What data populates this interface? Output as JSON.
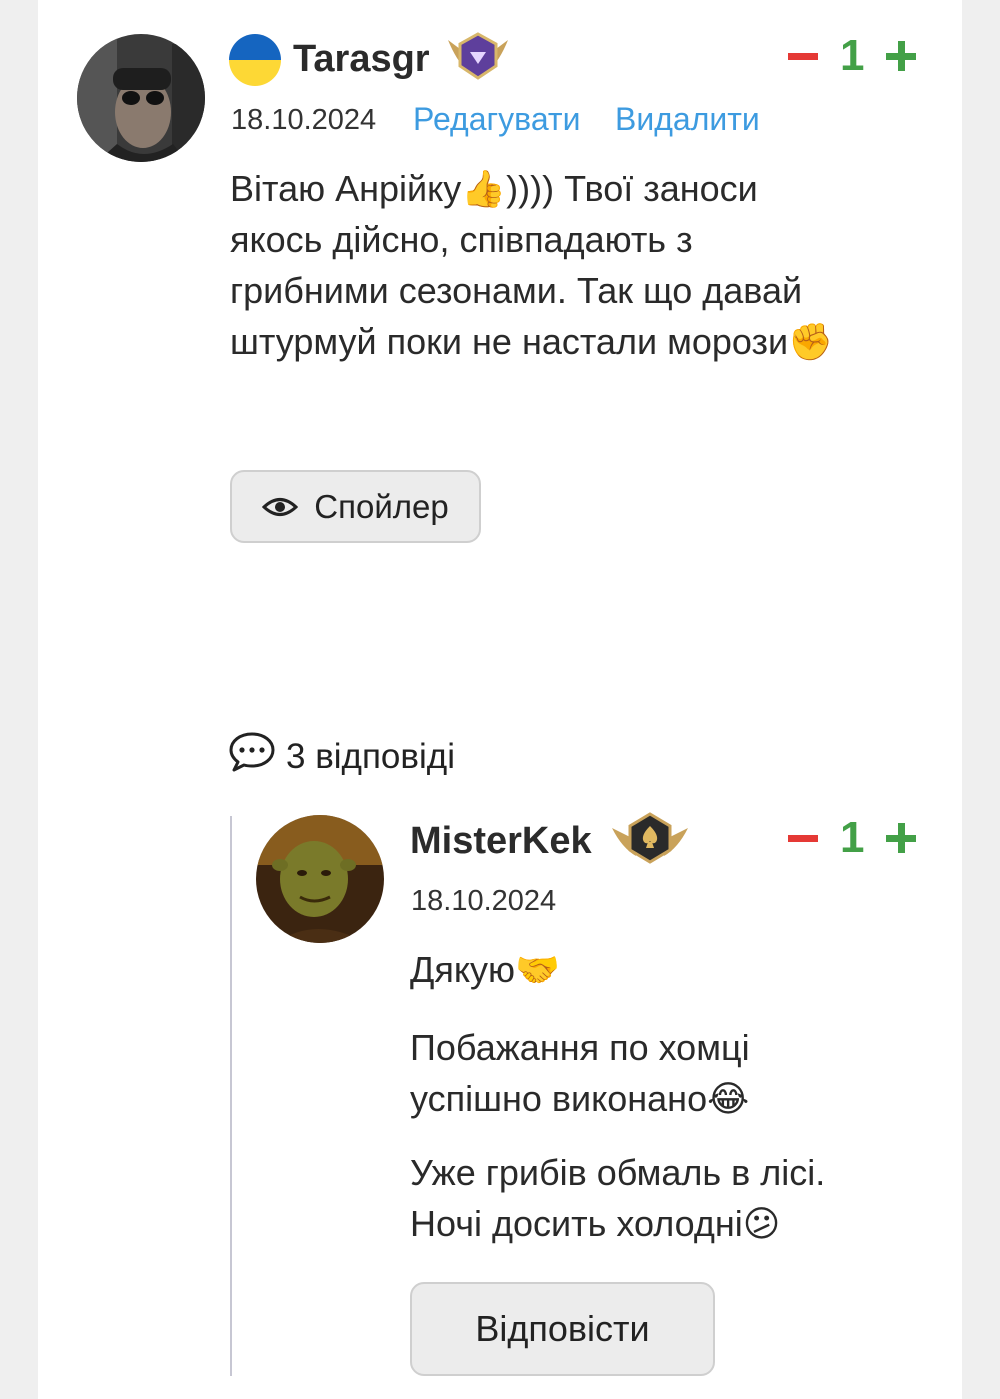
{
  "comment": {
    "username": "Tarasgr",
    "date": "18.10.2024",
    "edit_label": "Редагувати",
    "delete_label": "Видалити",
    "score": "1",
    "text_lines": [
      "Вітаю Анрійку👍)))) Твої заноси",
      "якось дійсно, співпадають з",
      "грибними сезонами. Так що давай",
      "штурмуй поки не настали морози✊"
    ],
    "spoiler_label": "Спойлер",
    "flag_colors": [
      "#1565c0",
      "#fdd835"
    ],
    "badge_icon": "diamond-wings-badge-icon"
  },
  "replies_label": "3 відповіді",
  "reply": {
    "username": "MisterKek",
    "date": "18.10.2024",
    "score": "1",
    "paragraphs": [
      [
        "Дякую🤝"
      ],
      [
        "Побажання по хомці",
        "успішно виконано😂"
      ],
      [
        "Уже грибів обмаль в лісі.",
        "Ночі досить холодні😕"
      ]
    ],
    "reply_button_label": "Відповісти",
    "badge_icon": "spade-wings-badge-icon"
  },
  "colors": {
    "minus": "#e53935",
    "plus": "#43a047",
    "link": "#3d9be0"
  }
}
